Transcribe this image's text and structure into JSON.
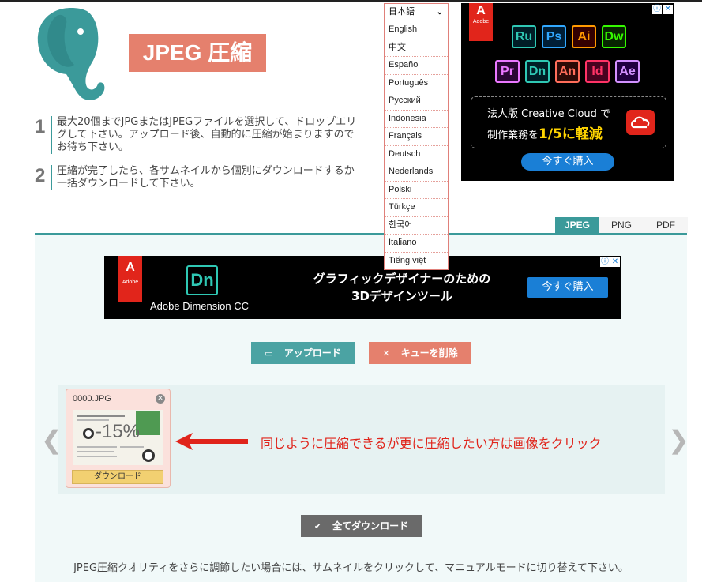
{
  "header": {
    "title": "JPEG 圧縮"
  },
  "steps": [
    {
      "num": "1",
      "text": "最大20個までJPGまたはJPEGファイルを選択して、ドロップエリ\nグして下さい。アップロード後、自動的に圧縮が始まりますので\nお待ち下さい。"
    },
    {
      "num": "2",
      "text": "圧縮が完了したら、各サムネイルから個別にダウンロードするか\n一括ダウンロードして下さい。"
    }
  ],
  "language": {
    "selected": "日本語",
    "options": [
      "English",
      "中文",
      "Español",
      "Português",
      "Русский",
      "Indonesia",
      "Français",
      "Deutsch",
      "Nederlands",
      "Polski",
      "Türkçe",
      "한국어",
      "Italiano",
      "Tiếng việt"
    ]
  },
  "ad_top": {
    "adobe": "Adobe",
    "icons": [
      "Ru",
      "Ps",
      "Ai",
      "Dw",
      "Pr",
      "Dn",
      "An",
      "Id",
      "Ae"
    ],
    "line1": "法人版 Creative Cloud で",
    "line2_prefix": "制作業務を",
    "line2_highlight": "1/5に軽減",
    "buy": "今すぐ購入"
  },
  "tabs": [
    "JPEG",
    "PNG",
    "PDF"
  ],
  "ad_banner": {
    "adobe": "Adobe",
    "app": "Dn",
    "product": "Adobe Dimension CC",
    "headline_l1": "グラフィックデザイナーのための",
    "headline_l2": "3Dデザインツール",
    "buy": "今すぐ購入"
  },
  "buttons": {
    "upload": "アップロード",
    "clear": "キューを削除",
    "download_all": "全てダウンロード"
  },
  "queue": {
    "file": {
      "name": "0000.JPG",
      "percent": "-15%",
      "download": "ダウンロード"
    },
    "annotation": "同じように圧縮できるが更に圧縮したい方は画像をクリック"
  },
  "footer": "JPEG圧縮クオリティをさらに調節したい場合には、サムネイルをクリックして、マニュアルモードに切り替えて下さい。",
  "colors": {
    "teal": "#3b9a9a",
    "salmon": "#e5806d",
    "adobe_red": "#e1251b"
  }
}
